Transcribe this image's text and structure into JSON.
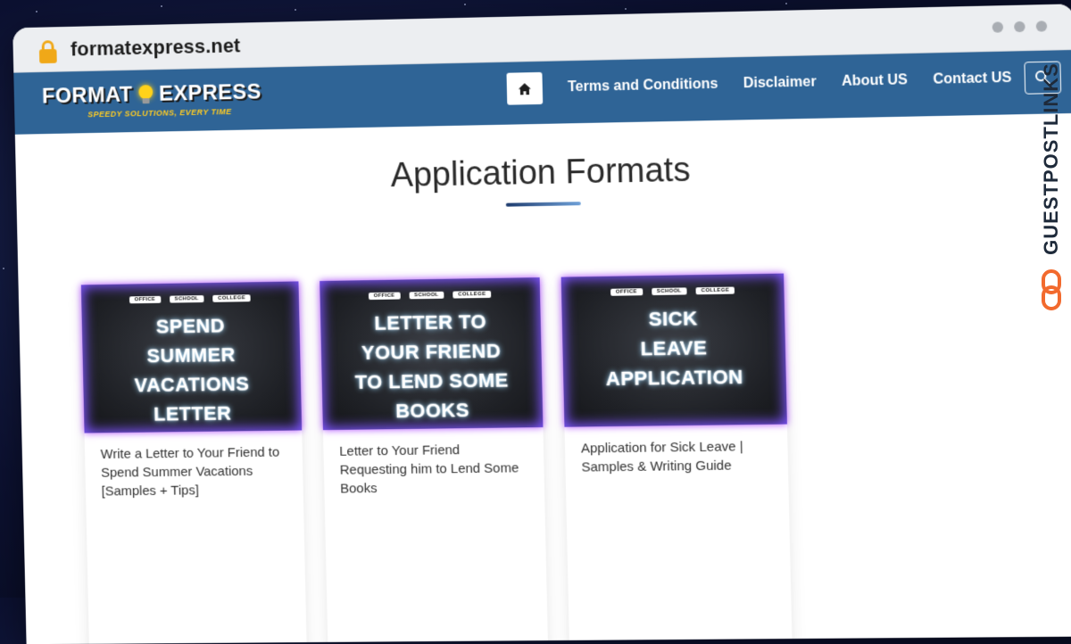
{
  "browser": {
    "url": "formatexpress.net"
  },
  "nav": {
    "logo": {
      "name_left": "FORMAT",
      "name_right": "EXPRESS",
      "tagline": "SPEEDY SOLUTIONS, EVERY TIME"
    },
    "items": [
      {
        "label": "Terms and Conditions"
      },
      {
        "label": "Disclaimer"
      },
      {
        "label": "About US"
      },
      {
        "label": "Contact US"
      }
    ],
    "icons": [
      "home-icon",
      "search-icon"
    ]
  },
  "main": {
    "title": "Application Formats",
    "cards": [
      {
        "tags": [
          "OFFICE",
          "SCHOOL",
          "COLLEGE"
        ],
        "thumb_text": "SPEND\nSUMMER\nVACATIONS\nLETTER",
        "title": "Write a Letter to Your Friend to Spend Summer Vacations [Samples + Tips]"
      },
      {
        "tags": [
          "OFFICE",
          "SCHOOL",
          "COLLEGE"
        ],
        "thumb_text": "LETTER TO\nYOUR FRIEND\nTO LEND SOME\nBOOKS",
        "title": "Letter to Your Friend Requesting him to Lend Some Books"
      },
      {
        "tags": [
          "OFFICE",
          "SCHOOL",
          "COLLEGE"
        ],
        "thumb_text": "SICK\nLEAVE\nAPPLICATION",
        "title": "Application for Sick Leave | Samples & Writing Guide"
      }
    ]
  },
  "watermark": {
    "text": "GUESTPOSTLINKS",
    "colors": {
      "text": "#1e2a3a",
      "icon": "#f26a2e"
    }
  },
  "colors": {
    "nav_bg": "#2f6496",
    "lock": "#f0a818",
    "thumb_glow": "#7f56ff"
  }
}
